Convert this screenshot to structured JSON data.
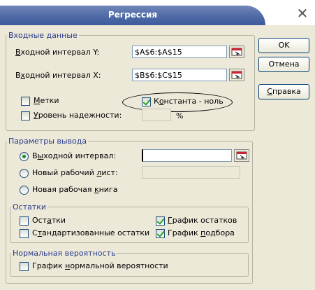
{
  "window": {
    "title": "Регрессия",
    "close_glyph": "✕"
  },
  "input_group": {
    "title": "Входные данные",
    "y_range": {
      "label_key": "В",
      "label_rest": "ходной интервал Y:",
      "value": "$A$6:$A$15"
    },
    "x_range": {
      "label_pre": "В",
      "label_key": "х",
      "label_rest": "одной интервал X:",
      "value": "$B$6:$C$15"
    },
    "labels_cb": {
      "label_key": "М",
      "label_rest": "етки",
      "checked": false
    },
    "confidence_cb": {
      "label_key": "У",
      "label_rest": "ровень надежности:",
      "checked": false,
      "unit": "%"
    },
    "constant_zero_cb": {
      "label_pre": "К",
      "label_key": "о",
      "label_rest": "нстанта - ноль",
      "checked": true
    }
  },
  "output_group": {
    "title": "Параметры вывода",
    "output_range": {
      "label_pre": "В",
      "label_key": "ы",
      "label_rest": "ходной интервал:",
      "selected": true
    },
    "new_sheet": {
      "label_pre": "Новый рабочий ",
      "label_key": "л",
      "label_rest": "ист:",
      "selected": false
    },
    "new_book": {
      "label_pre": "Новая рабочая ",
      "label_key": "к",
      "label_rest": "нига",
      "selected": false
    }
  },
  "residuals_group": {
    "title": "Остатки",
    "residuals": {
      "label_pre": "Ост",
      "label_key": "а",
      "label_rest": "тки",
      "checked": false
    },
    "std_residuals": {
      "label_pre": "С",
      "label_key": "т",
      "label_rest": "андартизованные остатки",
      "checked": false
    },
    "residual_plot": {
      "label_key": "Г",
      "label_rest": "рафик остатков",
      "checked": true
    },
    "fit_plot": {
      "label_pre": "График ",
      "label_key": "п",
      "label_rest": "одбора",
      "checked": true
    }
  },
  "normal_group": {
    "title": "Нормальная вероятность",
    "normal_plot": {
      "label_pre": "График ",
      "label_key": "н",
      "label_rest": "ормальной вероятности",
      "checked": false
    }
  },
  "buttons": {
    "ok": "OK",
    "cancel": "Отмена",
    "help_key": "С",
    "help_rest": "правка"
  },
  "colors": {
    "title_bar": "#4f6aa6",
    "dialog_bg": "#ece9d8",
    "group_title": "#2a3a8a"
  }
}
